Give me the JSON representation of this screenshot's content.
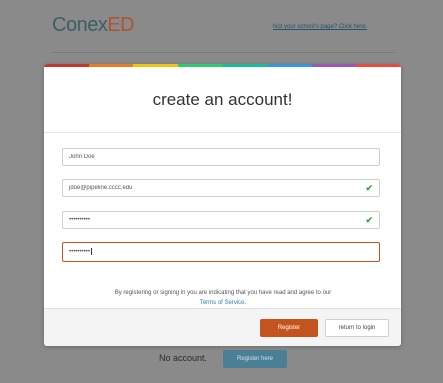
{
  "header": {
    "brand_main": "Conex",
    "brand_accent": "ED",
    "school_link": "Not your school's page? Click here."
  },
  "modal": {
    "title": "create an account!",
    "rainbow_colors": [
      "#c0392b",
      "#e67e22",
      "#f1c40f",
      "#2ecc71",
      "#1abc9c",
      "#3498db",
      "#9b59b6",
      "#e74c3c"
    ],
    "fields": {
      "name": {
        "value": "John Doe"
      },
      "email": {
        "value": "jdoe@pipeline.cccc.edu",
        "valid": true
      },
      "password": {
        "value": "••••••••••",
        "valid": true
      },
      "confirm_password": {
        "value": "••••••••••",
        "focused": true
      }
    },
    "terms": {
      "text": "By registering or signing in you are indicating that you have read and agree to our",
      "link": "Terms of Service",
      "suffix": "."
    },
    "register_button": "Register",
    "return_button": "return to login"
  },
  "page": {
    "no_account_label": "No account.",
    "register_here_button": "Register here"
  },
  "colors": {
    "accent": "#c4541e",
    "valid": "#3aa84a",
    "link": "#2a7fb0"
  }
}
